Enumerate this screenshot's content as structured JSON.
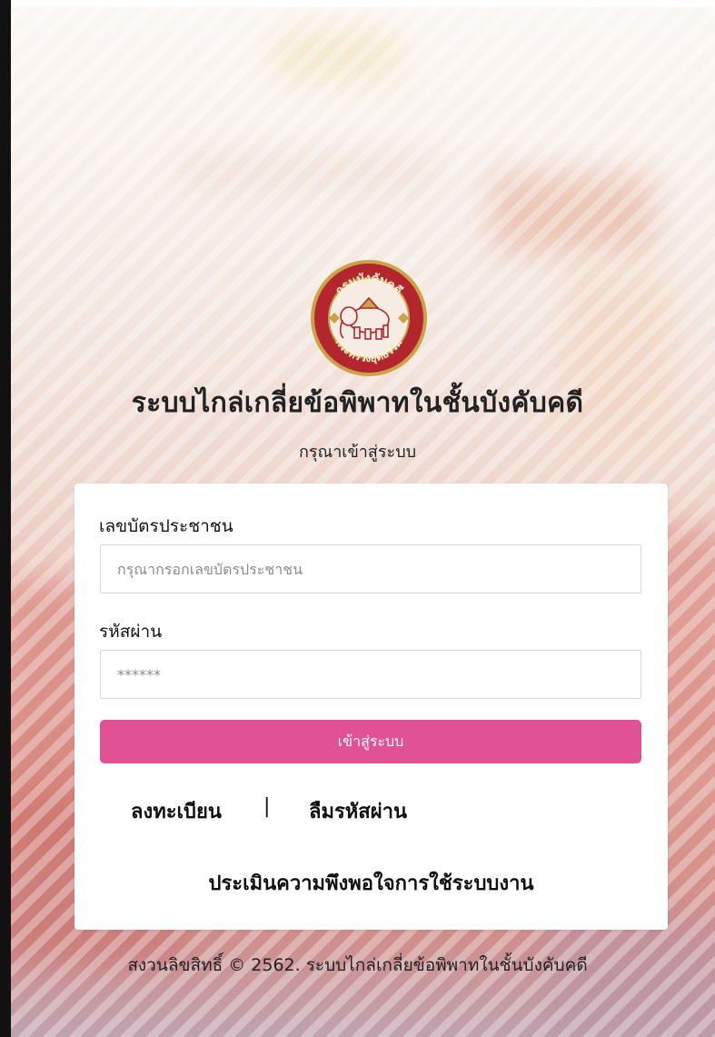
{
  "header": {
    "logo_icon": "department-seal-logo",
    "logo_top_text": "กรมบังคับคดี",
    "logo_bottom_text": "กระทรวงยุติธรรม",
    "title": "ระบบไกล่เกลี่ยข้อพิพาทในชั้นบังคับคดี",
    "subtitle": "กรุณาเข้าสู่ระบบ"
  },
  "login_form": {
    "id_label": "เลขบัตรประชาชน",
    "id_placeholder": "กรุณากรอกเลขบัตรประชาชน",
    "password_label": "รหัสผ่าน",
    "password_placeholder": "******",
    "submit_label": "เข้าสู่ระบบ",
    "register_link": "ลงทะเบียน",
    "separator": "|",
    "forgot_link": "ลืมรหัสผ่าน",
    "survey_link": "ประเมินความพึงพอใจการใช้ระบบงาน"
  },
  "footer": {
    "copyright": "สงวนลิขสิทธิ์ © 2562. ระบบไกล่เกลี่ยข้อพิพาทในชั้นบังคับคดี"
  },
  "colors": {
    "primary_button": "#e05293",
    "seal_red": "#b3262e",
    "seal_gold": "#c9a24a"
  }
}
